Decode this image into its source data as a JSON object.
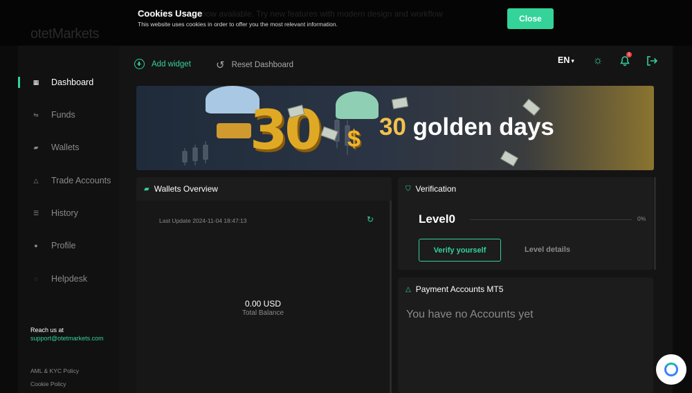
{
  "cookie": {
    "title": "Cookies Usage",
    "text": "This website uses cookies in order to offer you the most relevant information.",
    "close_label": "Close"
  },
  "topbar": {
    "logo_text_bold": "otet",
    "logo_text_light": "Markets",
    "announcement": "Trading Room is now available. Try new features with modern design and workflow"
  },
  "sidebar": {
    "items": [
      {
        "label": "Dashboard",
        "icon": "grid-icon",
        "active": true
      },
      {
        "label": "Funds",
        "icon": "transfer-icon",
        "active": false
      },
      {
        "label": "Wallets",
        "icon": "wallet-icon",
        "active": false
      },
      {
        "label": "Trade Accounts",
        "icon": "account-icon",
        "active": false
      },
      {
        "label": "History",
        "icon": "list-icon",
        "active": false
      },
      {
        "label": "Profile",
        "icon": "user-icon",
        "active": false
      },
      {
        "label": "Helpdesk",
        "icon": "chat-icon",
        "active": false
      }
    ],
    "reach_label": "Reach us at",
    "reach_email": "support@otetmarkets.com",
    "policy_aml": "AML & KYC Policy",
    "policy_cookie": "Cookie Policy"
  },
  "toolbar": {
    "add_widget": "Add widget",
    "reset_dashboard": "Reset Dashboard",
    "language": "EN",
    "notification_count": "1"
  },
  "banner": {
    "number": "30",
    "currency_symbol": "$",
    "highlight": "30",
    "headline": "golden days"
  },
  "wallets_overview": {
    "title": "Wallets Overview",
    "last_update": "Last Update 2024-11-04 18:47:13",
    "balance": "0.00 USD",
    "balance_label": "Total Balance"
  },
  "verification": {
    "title": "Verification",
    "level": "Level0",
    "progress_percent": 0,
    "progress_label": "0%",
    "verify_button": "Verify yourself",
    "level_details": "Level details"
  },
  "payment_accounts": {
    "title": "Payment Accounts MT5",
    "empty_text": "You have no Accounts yet"
  },
  "colors": {
    "accent": "#34d399",
    "background": "#0b0b0b",
    "card": "#1c1c1c",
    "notification": "#ef4444"
  }
}
